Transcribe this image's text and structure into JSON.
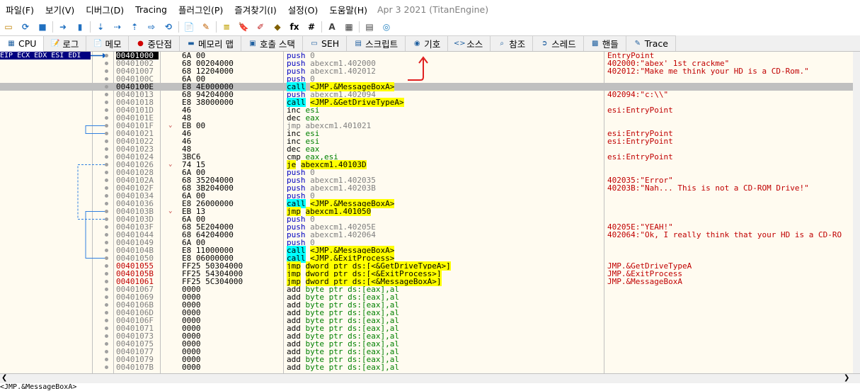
{
  "menu": [
    "파일(F)",
    "보기(V)",
    "디버그(D)",
    "Tracing",
    "플러그인(P)",
    "즐겨찾기(I)",
    "설정(O)",
    "도움말(H)"
  ],
  "build_date": "Apr 3 2021 (TitanEngine)",
  "toolbar_icons": [
    "open-icon",
    "restart-icon",
    "close-icon",
    "run-icon",
    "pause-icon",
    "step-into-icon",
    "step-over-icon",
    "step-out-icon",
    "run-to-user-icon",
    "trace-icon",
    "script-icon",
    "hide-debugger-icon",
    "patch-icon",
    "bookmark-icon",
    "comment-icon",
    "label-icon",
    "function-icon",
    "hash-icon",
    "font-icon",
    "memory-icon",
    "calculator-icon",
    "globe-icon"
  ],
  "toolbar_glyphs": [
    "▭",
    "⟳",
    "■",
    "➜",
    "▮",
    "⇣",
    "⇢",
    "⇡",
    "⇨",
    "⟲",
    "📄",
    "✎",
    "≡",
    "🔖",
    "✐",
    "◆",
    "fx",
    "#",
    "A",
    "▦",
    "▤",
    "◎"
  ],
  "tabs": [
    {
      "label": "CPU",
      "icon": "cpu-icon",
      "glyph": "▦",
      "active": true
    },
    {
      "label": "로그",
      "icon": "log-icon",
      "glyph": "📝"
    },
    {
      "label": "메모",
      "icon": "notes-icon",
      "glyph": "📄"
    },
    {
      "label": "중단점",
      "icon": "breakpoint-icon",
      "glyph": "●"
    },
    {
      "label": "메모리 맵",
      "icon": "memory-map-icon",
      "glyph": "▬"
    },
    {
      "label": "호출 스택",
      "icon": "call-stack-icon",
      "glyph": "▣"
    },
    {
      "label": "SEH",
      "icon": "seh-icon",
      "glyph": "▭"
    },
    {
      "label": "스크립트",
      "icon": "script-tab-icon",
      "glyph": "▤"
    },
    {
      "label": "기호",
      "icon": "symbols-icon",
      "glyph": "◉"
    },
    {
      "label": "소스",
      "icon": "source-icon",
      "glyph": "<>"
    },
    {
      "label": "참조",
      "icon": "references-icon",
      "glyph": "⌕"
    },
    {
      "label": "스레드",
      "icon": "threads-icon",
      "glyph": "➲"
    },
    {
      "label": "핸들",
      "icon": "handles-icon",
      "glyph": "▩"
    },
    {
      "label": "Trace",
      "icon": "trace-tab-icon",
      "glyph": "✎"
    }
  ],
  "registers_label": "EIP ECX EDX ESI EDI",
  "rows": [
    {
      "addr": "00401000",
      "bytes": "6A 00",
      "mn": "push",
      "ops": "0",
      "cmt": "EntryPoint",
      "eip": true
    },
    {
      "addr": "00401002",
      "bytes": "68 00204000",
      "mn": "push",
      "ops": "abexcm1.402000",
      "cmt": "402000:\"abex' 1st crackme\""
    },
    {
      "addr": "00401007",
      "bytes": "68 12204000",
      "mn": "push",
      "ops": "abexcm1.402012",
      "cmt": "402012:\"Make me think your HD is a CD-Rom.\""
    },
    {
      "addr": "0040100C",
      "bytes": "6A 00",
      "mn": "push",
      "ops": "0",
      "cmt": ""
    },
    {
      "addr": "0040100E",
      "bytes": "E8 4E000000",
      "mn": "call",
      "ops": "<JMP.&MessageBoxA>",
      "cmt": "",
      "sel": true
    },
    {
      "addr": "00401013",
      "bytes": "68 94204000",
      "mn": "push",
      "ops": "abexcm1.402094",
      "cmt": "402094:\"c:\\\\\""
    },
    {
      "addr": "00401018",
      "bytes": "E8 38000000",
      "mn": "call",
      "ops": "<JMP.&GetDriveTypeA>",
      "cmt": ""
    },
    {
      "addr": "0040101D",
      "bytes": "46",
      "mn": "inc",
      "ops": "esi",
      "cmt": "esi:EntryPoint"
    },
    {
      "addr": "0040101E",
      "bytes": "48",
      "mn": "dec",
      "ops": "eax",
      "cmt": ""
    },
    {
      "addr": "0040101F",
      "bytes": "EB 00",
      "mn": "jmp",
      "ops": "abexcm1.401021",
      "cmt": "",
      "dim": true
    },
    {
      "addr": "00401021",
      "bytes": "46",
      "mn": "inc",
      "ops": "esi",
      "cmt": "esi:EntryPoint"
    },
    {
      "addr": "00401022",
      "bytes": "46",
      "mn": "inc",
      "ops": "esi",
      "cmt": "esi:EntryPoint"
    },
    {
      "addr": "00401023",
      "bytes": "48",
      "mn": "dec",
      "ops": "eax",
      "cmt": ""
    },
    {
      "addr": "00401024",
      "bytes": "3BC6",
      "mn": "cmp",
      "ops": "eax,esi",
      "cmt": "esi:EntryPoint"
    },
    {
      "addr": "00401026",
      "bytes": "74 15",
      "mn": "je",
      "ops": "abexcm1.40103D",
      "cmt": ""
    },
    {
      "addr": "00401028",
      "bytes": "6A 00",
      "mn": "push",
      "ops": "0",
      "cmt": ""
    },
    {
      "addr": "0040102A",
      "bytes": "68 35204000",
      "mn": "push",
      "ops": "abexcm1.402035",
      "cmt": "402035:\"Error\""
    },
    {
      "addr": "0040102F",
      "bytes": "68 3B204000",
      "mn": "push",
      "ops": "abexcm1.40203B",
      "cmt": "40203B:\"Nah... This is not a CD-ROM Drive!\""
    },
    {
      "addr": "00401034",
      "bytes": "6A 00",
      "mn": "push",
      "ops": "0",
      "cmt": ""
    },
    {
      "addr": "00401036",
      "bytes": "E8 26000000",
      "mn": "call",
      "ops": "<JMP.&MessageBoxA>",
      "cmt": ""
    },
    {
      "addr": "0040103B",
      "bytes": "EB 13",
      "mn": "jmp",
      "ops": "abexcm1.401050",
      "cmt": ""
    },
    {
      "addr": "0040103D",
      "bytes": "6A 00",
      "mn": "push",
      "ops": "0",
      "cmt": ""
    },
    {
      "addr": "0040103F",
      "bytes": "68 5E204000",
      "mn": "push",
      "ops": "abexcm1.40205E",
      "cmt": "40205E:\"YEAH!\""
    },
    {
      "addr": "00401044",
      "bytes": "68 64204000",
      "mn": "push",
      "ops": "abexcm1.402064",
      "cmt": "402064:\"Ok, I really think that your HD is a CD-RO"
    },
    {
      "addr": "00401049",
      "bytes": "6A 00",
      "mn": "push",
      "ops": "0",
      "cmt": ""
    },
    {
      "addr": "0040104B",
      "bytes": "E8 11000000",
      "mn": "call",
      "ops": "<JMP.&MessageBoxA>",
      "cmt": ""
    },
    {
      "addr": "00401050",
      "bytes": "E8 06000000",
      "mn": "call",
      "ops": "<JMP.&ExitProcess>",
      "cmt": ""
    },
    {
      "addr": "00401055",
      "bytes": "FF25 50304000",
      "mn": "jmp",
      "ops": "dword ptr ds:[<&GetDriveTypeA>]",
      "cmt": "JMP.&GetDriveTypeA",
      "red": true
    },
    {
      "addr": "0040105B",
      "bytes": "FF25 54304000",
      "mn": "jmp",
      "ops": "dword ptr ds:[<&ExitProcess>]",
      "cmt": "JMP.&ExitProcess",
      "red": true
    },
    {
      "addr": "00401061",
      "bytes": "FF25 5C304000",
      "mn": "jmp",
      "ops": "dword ptr ds:[<&MessageBoxA>]",
      "cmt": "JMP.&MessageBoxA",
      "red": true
    },
    {
      "addr": "00401067",
      "bytes": "0000",
      "mn": "add",
      "ops": "byte ptr ds:[eax],al",
      "cmt": ""
    },
    {
      "addr": "00401069",
      "bytes": "0000",
      "mn": "add",
      "ops": "byte ptr ds:[eax],al",
      "cmt": ""
    },
    {
      "addr": "0040106B",
      "bytes": "0000",
      "mn": "add",
      "ops": "byte ptr ds:[eax],al",
      "cmt": ""
    },
    {
      "addr": "0040106D",
      "bytes": "0000",
      "mn": "add",
      "ops": "byte ptr ds:[eax],al",
      "cmt": ""
    },
    {
      "addr": "0040106F",
      "bytes": "0000",
      "mn": "add",
      "ops": "byte ptr ds:[eax],al",
      "cmt": ""
    },
    {
      "addr": "00401071",
      "bytes": "0000",
      "mn": "add",
      "ops": "byte ptr ds:[eax],al",
      "cmt": ""
    },
    {
      "addr": "00401073",
      "bytes": "0000",
      "mn": "add",
      "ops": "byte ptr ds:[eax],al",
      "cmt": ""
    },
    {
      "addr": "00401075",
      "bytes": "0000",
      "mn": "add",
      "ops": "byte ptr ds:[eax],al",
      "cmt": ""
    },
    {
      "addr": "00401077",
      "bytes": "0000",
      "mn": "add",
      "ops": "byte ptr ds:[eax],al",
      "cmt": ""
    },
    {
      "addr": "00401079",
      "bytes": "0000",
      "mn": "add",
      "ops": "byte ptr ds:[eax],al",
      "cmt": ""
    },
    {
      "addr": "0040107B",
      "bytes": "0000",
      "mn": "add",
      "ops": "byte ptr ds:[eax],al",
      "cmt": ""
    }
  ],
  "status_text": "<JMP.&MessageBoxA>",
  "colors": {
    "call_bg": "#00ffff",
    "jmp_bg": "#ffff00",
    "comment": "#c00000",
    "eip_bg": "#000080",
    "address": "#808080"
  }
}
